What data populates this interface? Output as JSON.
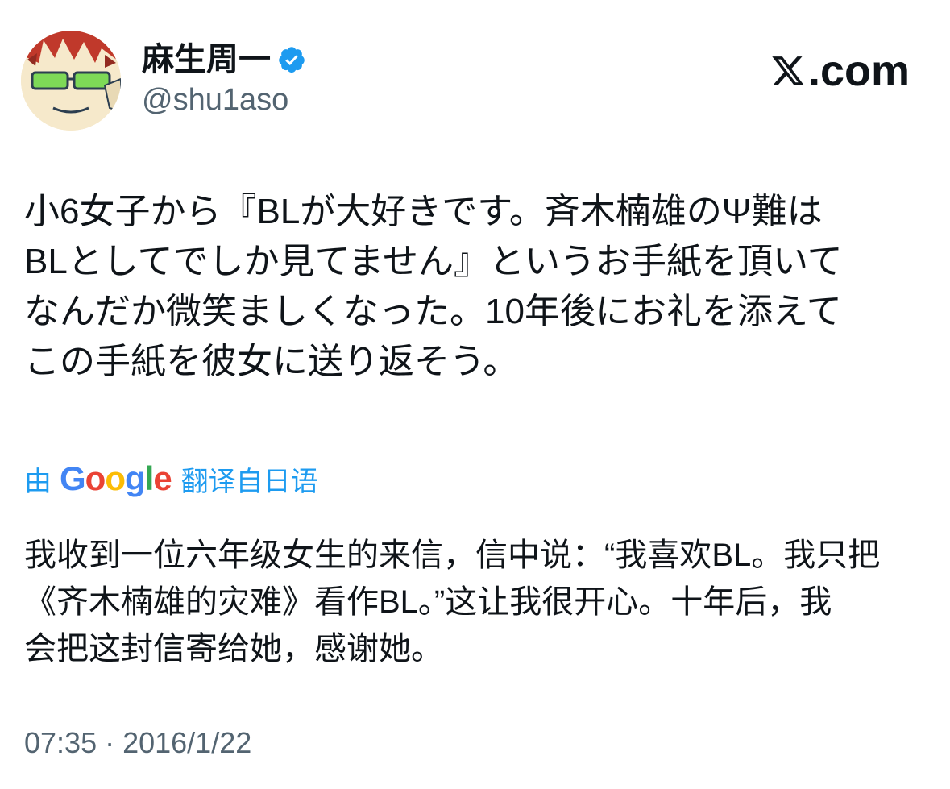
{
  "author": {
    "name": "麻生周一",
    "handle": "@shu1aso",
    "verified_icon": "verified-badge-icon",
    "avatar_icon": "avatar-image"
  },
  "brand": {
    "logo_text": ".com",
    "logo_icon": "x-logo-icon"
  },
  "tweet": {
    "text": "小6女子から『BLが大好きです。斉木楠雄のΨ難は\nBLとしてでしか見てません』というお手紙を頂いて\nなんだか微笑ましくなった。10年後にお礼を添えて\nこの手紙を彼女に送り返そう。"
  },
  "translation": {
    "prefix": "由",
    "provider_letters": [
      "G",
      "o",
      "o",
      "g",
      "l",
      "e"
    ],
    "suffix": "翻译自日语",
    "text": "我收到一位六年级女生的来信，信中说：“我喜欢BL。我只把\n《齐木楠雄的灾难》看作BL。”这让我很开心。十年后，我\n会把这封信寄给她，感谢她。"
  },
  "meta": {
    "timestamp": "07:35 · 2016/1/22"
  },
  "colors": {
    "link_blue": "#1d9bf0",
    "secondary_text": "#536471",
    "primary_text": "#0f1419"
  }
}
